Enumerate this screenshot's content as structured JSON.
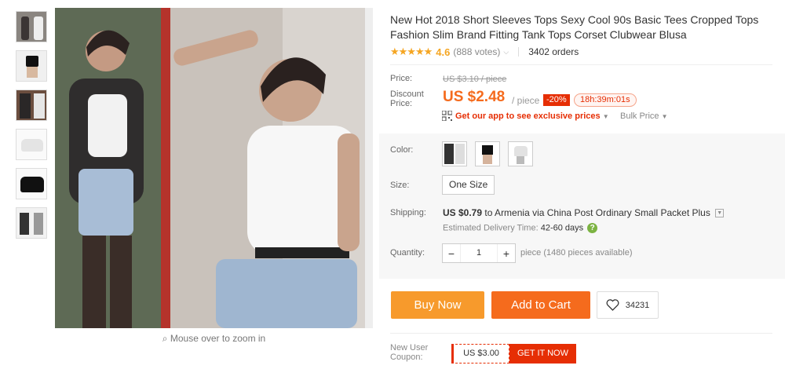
{
  "gallery": {
    "thumbnails": [
      "thumb-1",
      "thumb-2",
      "thumb-3",
      "thumb-4",
      "thumb-5",
      "thumb-6"
    ],
    "zoom_hint": "Mouse over to zoom in"
  },
  "product": {
    "title": "New Hot 2018 Short Sleeves Tops Sexy Cool 90s Basic Tees Cropped Tops Fashion Slim Brand Fitting Tank Tops Corset Clubwear Blusa",
    "rating": "4.6",
    "votes": "(888 votes)",
    "orders": "3402 orders"
  },
  "price": {
    "label": "Price:",
    "original": "US $3.10 / piece",
    "discount_label": "Discount\nPrice:",
    "current": "US $2.48",
    "per_piece": "/ piece",
    "discount": "-20%",
    "timer": "18h:39m:01s",
    "app_link": "Get our app to see exclusive prices",
    "bulk": "Bulk Price"
  },
  "options": {
    "color_label": "Color:",
    "colors": [
      "black-white-collage",
      "black-crop-top",
      "white-crop-top"
    ],
    "size_label": "Size:",
    "size": "One Size"
  },
  "shipping": {
    "label": "Shipping:",
    "price": "US $0.79",
    "text": " to Armenia via China Post Ordinary Small Packet Plus",
    "delivery_label": "Estimated Delivery Time:",
    "delivery_value": "42-60 days"
  },
  "quantity": {
    "label": "Quantity:",
    "value": "1",
    "minus": "−",
    "plus": "+",
    "note": "piece (1480 pieces available)"
  },
  "actions": {
    "buy_now": "Buy Now",
    "add_to_cart": "Add to Cart",
    "wishlist_count": "34231"
  },
  "coupon": {
    "label": "New User\nCoupon:",
    "value": "US $3.00",
    "button": "GET IT NOW"
  },
  "colors": {
    "accent": "#f56b1d",
    "buy": "#f79a2c",
    "red": "#e62e04",
    "star": "#f5a623"
  }
}
